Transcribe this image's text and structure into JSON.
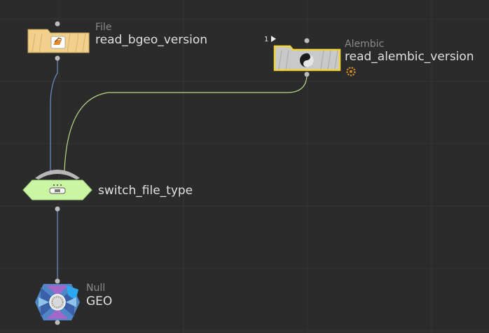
{
  "nodes": {
    "file": {
      "type_label": "File",
      "name": "read_bgeo_version"
    },
    "alembic": {
      "type_label": "Alembic",
      "name": "read_alembic_version",
      "input_count": "1",
      "status_icon": "gear-icon"
    },
    "switch": {
      "name": "switch_file_type"
    },
    "null": {
      "type_label": "Null",
      "name": "GEO"
    }
  },
  "colors": {
    "background": "#2b2b2b",
    "grid": "#363636",
    "file_node": "#f0d08a",
    "alembic_node": "#c9c9c9",
    "alembic_selected_outline": "#f2d43a",
    "switch_node": "#caf5a2",
    "null_node": "#4f86c6",
    "wire_blue": "#6f8fc4",
    "wire_green": "#b9d98a"
  }
}
